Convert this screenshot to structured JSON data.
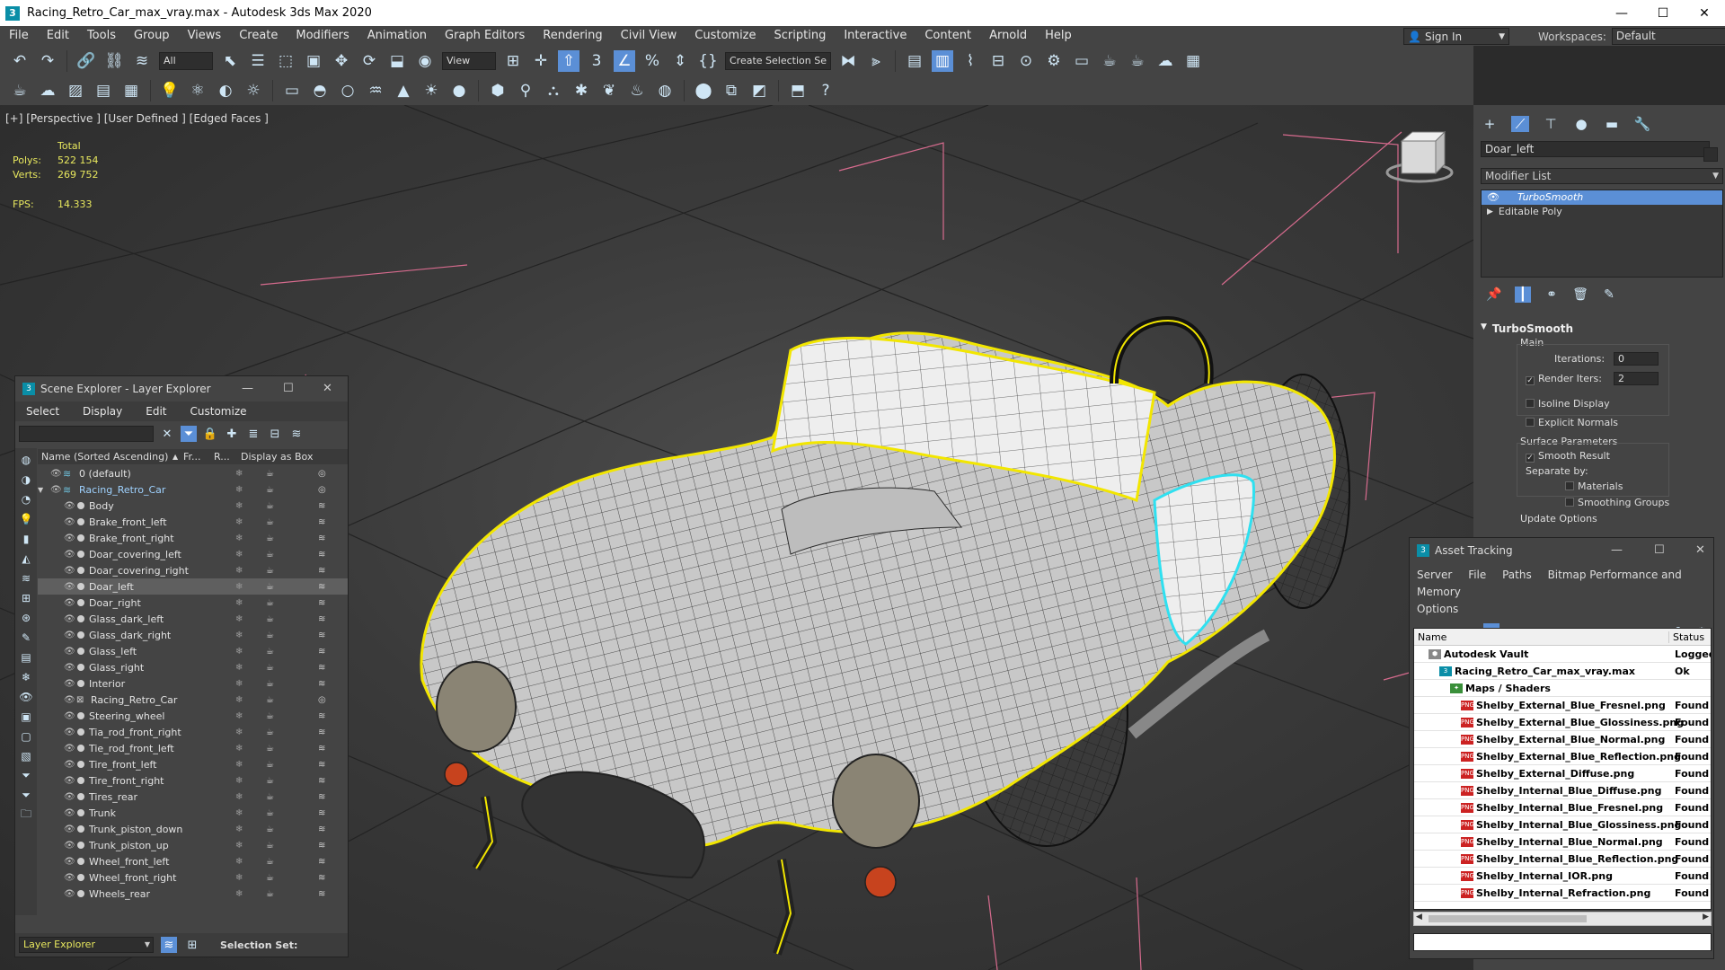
{
  "window": {
    "title": "Racing_Retro_Car_max_vray.max - Autodesk 3ds Max 2020",
    "app_icon": "3"
  },
  "menubar": [
    "File",
    "Edit",
    "Tools",
    "Group",
    "Views",
    "Create",
    "Modifiers",
    "Animation",
    "Graph Editors",
    "Rendering",
    "Civil View",
    "Customize",
    "Scripting",
    "Interactive",
    "Content",
    "Arnold",
    "Help"
  ],
  "signin": {
    "label": "Sign In"
  },
  "workspaces": {
    "label": "Workspaces:",
    "value": "Default"
  },
  "toolbar1": {
    "filter": "All",
    "ref_coord": "View",
    "selection_set": "Create Selection Se"
  },
  "viewport": {
    "label": "[+] [Perspective ] [User Defined ] [Edged Faces ]",
    "stats": {
      "header": "Total",
      "polys_label": "Polys:",
      "polys": "522 154",
      "verts_label": "Verts:",
      "verts": "269 752",
      "fps_label": "FPS:",
      "fps": "14.333"
    }
  },
  "command_panel": {
    "object_name": "Doar_left",
    "modifier_list": "Modifier List",
    "stack": [
      "TurboSmooth",
      "Editable Poly"
    ],
    "rollout": "TurboSmooth",
    "main_label": "Main",
    "iterations_label": "Iterations:",
    "iterations": "0",
    "render_iters_label": "Render Iters:",
    "render_iters": "2",
    "isoline": "Isoline Display",
    "explicit_normals": "Explicit Normals",
    "surface_params": "Surface Parameters",
    "smooth_result": "Smooth Result",
    "separate_by": "Separate by:",
    "materials": "Materials",
    "smoothing_groups": "Smoothing Groups",
    "update_options": "Update Options"
  },
  "scene_explorer": {
    "title": "Scene Explorer - Layer Explorer",
    "menu": [
      "Select",
      "Display",
      "Edit",
      "Customize"
    ],
    "columns": {
      "name": "Name (Sorted Ascending)",
      "frozen": "Fr...",
      "render": "R...",
      "box": "Display as Box"
    },
    "rows": [
      {
        "name": "0 (default)",
        "indent": 0,
        "kind": "layer"
      },
      {
        "name": "Racing_Retro_Car",
        "indent": 0,
        "kind": "layer-open"
      },
      {
        "name": "Body",
        "indent": 1,
        "kind": "obj"
      },
      {
        "name": "Brake_front_left",
        "indent": 1,
        "kind": "obj"
      },
      {
        "name": "Brake_front_right",
        "indent": 1,
        "kind": "obj"
      },
      {
        "name": "Doar_covering_left",
        "indent": 1,
        "kind": "obj"
      },
      {
        "name": "Doar_covering_right",
        "indent": 1,
        "kind": "obj"
      },
      {
        "name": "Doar_left",
        "indent": 1,
        "kind": "obj",
        "selected": true
      },
      {
        "name": "Doar_right",
        "indent": 1,
        "kind": "obj"
      },
      {
        "name": "Glass_dark_left",
        "indent": 1,
        "kind": "obj"
      },
      {
        "name": "Glass_dark_right",
        "indent": 1,
        "kind": "obj"
      },
      {
        "name": "Glass_left",
        "indent": 1,
        "kind": "obj"
      },
      {
        "name": "Glass_right",
        "indent": 1,
        "kind": "obj"
      },
      {
        "name": "Interior",
        "indent": 1,
        "kind": "obj"
      },
      {
        "name": "Racing_Retro_Car",
        "indent": 1,
        "kind": "dummy"
      },
      {
        "name": "Steering_wheel",
        "indent": 1,
        "kind": "obj"
      },
      {
        "name": "Tia_rod_front_right",
        "indent": 1,
        "kind": "obj"
      },
      {
        "name": "Tie_rod_front_left",
        "indent": 1,
        "kind": "obj"
      },
      {
        "name": "Tire_front_left",
        "indent": 1,
        "kind": "obj"
      },
      {
        "name": "Tire_front_right",
        "indent": 1,
        "kind": "obj"
      },
      {
        "name": "Tires_rear",
        "indent": 1,
        "kind": "obj"
      },
      {
        "name": "Trunk",
        "indent": 1,
        "kind": "obj"
      },
      {
        "name": "Trunk_piston_down",
        "indent": 1,
        "kind": "obj"
      },
      {
        "name": "Trunk_piston_up",
        "indent": 1,
        "kind": "obj"
      },
      {
        "name": "Wheel_front_left",
        "indent": 1,
        "kind": "obj"
      },
      {
        "name": "Wheel_front_right",
        "indent": 1,
        "kind": "obj"
      },
      {
        "name": "Wheels_rear",
        "indent": 1,
        "kind": "obj"
      }
    ],
    "footer": {
      "explorer": "Layer Explorer",
      "selection_set": "Selection Set:"
    }
  },
  "asset_tracking": {
    "title": "Asset Tracking",
    "menu": [
      "Server",
      "File",
      "Paths",
      "Bitmap Performance and Memory",
      "Options"
    ],
    "columns": {
      "name": "Name",
      "status": "Status"
    },
    "rows": [
      {
        "name": "Autodesk Vault",
        "status": "Logged",
        "indent": 1,
        "icon": "vault"
      },
      {
        "name": "Racing_Retro_Car_max_vray.max",
        "status": "Ok",
        "indent": 2,
        "icon": "max"
      },
      {
        "name": "Maps / Shaders",
        "status": "",
        "indent": 3,
        "icon": "fold"
      },
      {
        "name": "Shelby_External_Blue_Fresnel.png",
        "status": "Found",
        "indent": 4,
        "icon": "png"
      },
      {
        "name": "Shelby_External_Blue_Glossiness.png",
        "status": "Found",
        "indent": 4,
        "icon": "png"
      },
      {
        "name": "Shelby_External_Blue_Normal.png",
        "status": "Found",
        "indent": 4,
        "icon": "png"
      },
      {
        "name": "Shelby_External_Blue_Reflection.png",
        "status": "Found",
        "indent": 4,
        "icon": "png"
      },
      {
        "name": "Shelby_External_Diffuse.png",
        "status": "Found",
        "indent": 4,
        "icon": "png"
      },
      {
        "name": "Shelby_Internal_Blue_Diffuse.png",
        "status": "Found",
        "indent": 4,
        "icon": "png"
      },
      {
        "name": "Shelby_Internal_Blue_Fresnel.png",
        "status": "Found",
        "indent": 4,
        "icon": "png"
      },
      {
        "name": "Shelby_Internal_Blue_Glossiness.png",
        "status": "Found",
        "indent": 4,
        "icon": "png"
      },
      {
        "name": "Shelby_Internal_Blue_Normal.png",
        "status": "Found",
        "indent": 4,
        "icon": "png"
      },
      {
        "name": "Shelby_Internal_Blue_Reflection.png",
        "status": "Found",
        "indent": 4,
        "icon": "png"
      },
      {
        "name": "Shelby_Internal_IOR.png",
        "status": "Found",
        "indent": 4,
        "icon": "png"
      },
      {
        "name": "Shelby_Internal_Refraction.png",
        "status": "Found",
        "indent": 4,
        "icon": "png"
      }
    ]
  },
  "colors": {
    "accent": "#5b8fd6",
    "selection_outline": "#f2e600",
    "sub_selection": "#2fe0f0",
    "ui_bg": "#444444"
  }
}
